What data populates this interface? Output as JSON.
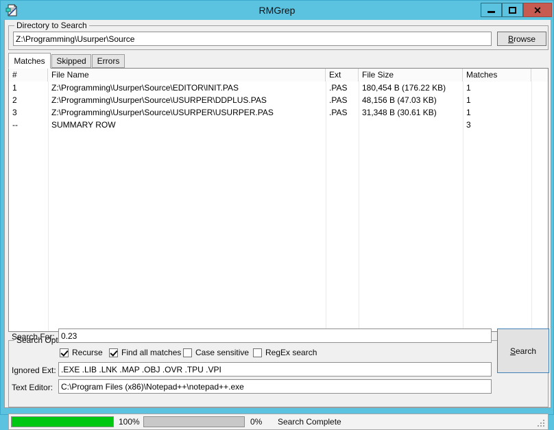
{
  "window": {
    "title": "RMGrep",
    "icon": "document-search-icon",
    "titlebar_color": "#5bc2e0",
    "close_color": "#c75b52",
    "controls": {
      "minimize": "minimize-icon",
      "maximize": "maximize-icon",
      "close": "close-icon"
    }
  },
  "directory_group": {
    "label": "Directory to Search",
    "path_value": "Z:\\Programming\\Usurper\\Source",
    "path_placeholder": "",
    "browse_label": "Browse",
    "browse_accel": "B"
  },
  "tabs": [
    {
      "label": "Matches",
      "active": true
    },
    {
      "label": "Skipped",
      "active": false
    },
    {
      "label": "Errors",
      "active": false
    }
  ],
  "listview": {
    "columns": [
      "#",
      "File Name",
      "Ext",
      "File Size",
      "Matches",
      ""
    ],
    "rows": [
      {
        "num": "1",
        "file_name": "Z:\\Programming\\Usurper\\Source\\EDITOR\\INIT.PAS",
        "ext": ".PAS",
        "file_size": "180,454 B (176.22 KB)",
        "matches": "1"
      },
      {
        "num": "2",
        "file_name": "Z:\\Programming\\Usurper\\Source\\USURPER\\DDPLUS.PAS",
        "ext": ".PAS",
        "file_size": "48,156 B (47.03 KB)",
        "matches": "1"
      },
      {
        "num": "3",
        "file_name": "Z:\\Programming\\Usurper\\Source\\USURPER\\USURPER.PAS",
        "ext": ".PAS",
        "file_size": "31,348 B (30.61 KB)",
        "matches": "1"
      },
      {
        "num": "--",
        "file_name": "SUMMARY ROW",
        "ext": "",
        "file_size": "",
        "matches": "3"
      }
    ]
  },
  "search_options": {
    "label": "Search Options",
    "search_for_label": "Search For:",
    "search_for_value": "0.23",
    "ignored_ext_label": "Ignored Ext:",
    "ignored_ext_value": ".EXE .LIB .LNK .MAP .OBJ .OVR .TPU .VPI",
    "text_editor_label": "Text Editor:",
    "text_editor_value": "C:\\Program Files (x86)\\Notepad++\\notepad++.exe",
    "checkboxes": [
      {
        "label": "Recurse",
        "checked": true
      },
      {
        "label": "Find all matches",
        "checked": true
      },
      {
        "label": "Case sensitive",
        "checked": false
      },
      {
        "label": "RegEx search",
        "checked": false
      }
    ],
    "search_button_label": "Search",
    "search_button_accel": "S"
  },
  "status": {
    "progress1_percent": 100,
    "progress1_text": "100%",
    "progress2_percent": 0,
    "progress2_text": "0%",
    "message": "Search Complete",
    "progress_color": "#00c812"
  }
}
